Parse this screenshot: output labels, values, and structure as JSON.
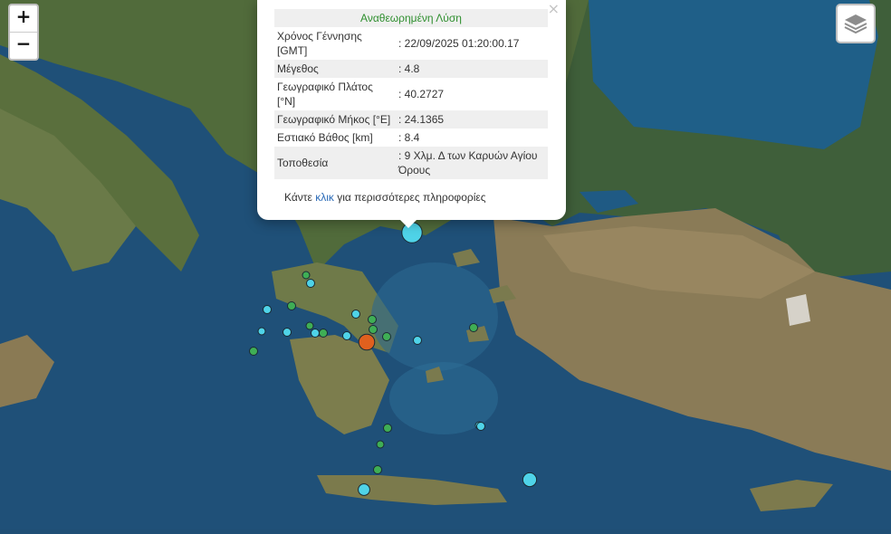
{
  "zoom": {
    "in": "+",
    "out": "−"
  },
  "popup": {
    "close": "×",
    "title": "Αναθεωρημένη Λύση",
    "rows": [
      {
        "k": "Χρόνος Γέννησης [GMT]",
        "v": ": 22/09/2025 01:20:00.17"
      },
      {
        "k": "Μέγεθος",
        "v": ": 4.8"
      },
      {
        "k": "Γεωγραφικό Πλάτος [°N]",
        "v": ": 40.2727"
      },
      {
        "k": "Γεωγραφικό Μήκος [°E]",
        "v": ": 24.1365"
      },
      {
        "k": "Εστιακό Βάθος [km]",
        "v": ": 8.4"
      },
      {
        "k": "Τοποθεσία",
        "v": ": 9 Χλμ. Δ των Καρυών Αγίου Όρους"
      }
    ],
    "more_pre": "Κάντε ",
    "more_link": "κλικ",
    "more_post": " για περισσότερες πληροφορίες"
  },
  "colors": {
    "sea_deep": "#1c4b73",
    "sea_shallow": "#3a86a8",
    "land_green": "#4f6b3a",
    "land_brown": "#8f7f5d",
    "marker_green": "#3fae55",
    "marker_cyan": "#4fd3e8",
    "marker_orange": "#e0601e"
  },
  "markers": [
    {
      "color": "cyan",
      "mag": 4.8,
      "label": "selected"
    },
    {
      "color": "orange",
      "mag": 4.2
    },
    {
      "color": "cyan",
      "mag": 3.9
    },
    {
      "color": "cyan",
      "mag": 3.6
    },
    {
      "color": "cyan",
      "mag": 2.9
    },
    {
      "color": "cyan",
      "mag": 2.8
    },
    {
      "color": "green",
      "mag": 2.7
    },
    {
      "color": "green",
      "mag": 2.6
    },
    {
      "color": "green",
      "mag": 2.5
    }
  ]
}
